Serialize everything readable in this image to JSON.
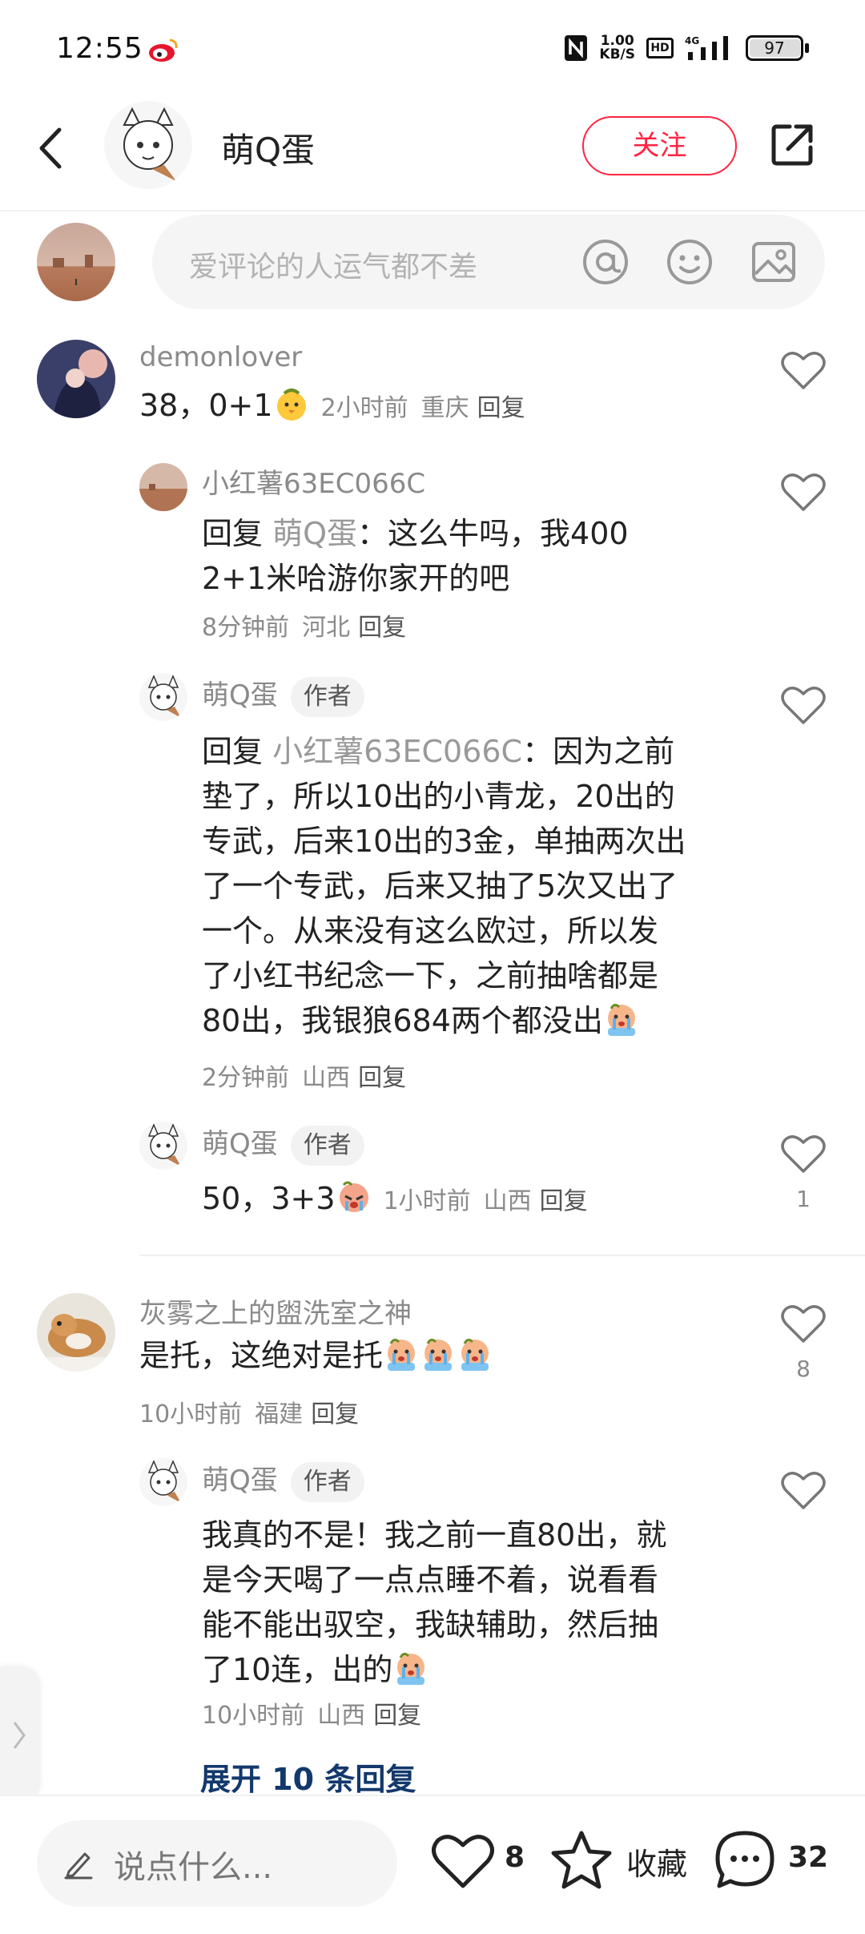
{
  "status_bar": {
    "time": "12:55",
    "net_speed_value": "1.00",
    "net_speed_unit": "KB/S",
    "hd": "HD",
    "signal": "4G",
    "battery": "97"
  },
  "header": {
    "author_name": "萌Q蛋",
    "follow_label": "关注"
  },
  "top_input": {
    "placeholder": "爱评论的人运气都不差"
  },
  "comments": [
    {
      "username": "demonlover",
      "text": "38，0+1",
      "time": "2小时前",
      "location": "重庆",
      "reply_label": "回复"
    },
    {
      "username": "小红薯63EC066C",
      "reply_prefix": "回复",
      "reply_to": "萌Q蛋",
      "text_line1": "：这么牛吗，我400",
      "text_line2": "2+1米哈游你家开的吧",
      "time": "8分钟前",
      "location": "河北",
      "reply_label": "回复"
    },
    {
      "username": "萌Q蛋",
      "badge": "作者",
      "reply_prefix": "回复",
      "reply_to": "小红薯63EC066C",
      "text_line1": "：因为之前",
      "text_lines": [
        "垫了，所以10出的小青龙，20出的",
        "专武，后来10出的3金，单抽两次出",
        "了一个专武，后来又抽了5次又出了",
        "一个。从来没有这么欧过，所以发",
        "了小红书纪念一下，之前抽啥都是",
        "80出，我银狼684两个都没出"
      ],
      "time": "2分钟前",
      "location": "山西",
      "reply_label": "回复"
    },
    {
      "username": "萌Q蛋",
      "badge": "作者",
      "text": "50，3+3",
      "time": "1小时前",
      "location": "山西",
      "reply_label": "回复",
      "likes": "1"
    },
    {
      "username": "灰雾之上的盥洗室之神",
      "text": "是托，这绝对是托",
      "time": "10小时前",
      "location": "福建",
      "reply_label": "回复",
      "likes": "8"
    },
    {
      "username": "萌Q蛋",
      "badge": "作者",
      "text_lines": [
        "我真的不是！我之前一直80出，就",
        "是今天喝了一点点睡不着，说看看",
        "能不能出驭空，我缺辅助，然后抽",
        "了10连，出的"
      ],
      "time": "10小时前",
      "location": "山西",
      "reply_label": "回复"
    }
  ],
  "expand_replies_label": "展开 10 条回复",
  "bottom_bar": {
    "input_placeholder": "说点什么...",
    "like_count": "8",
    "collect_label": "收藏",
    "comment_count": "32"
  },
  "colors": {
    "accent": "#ff2442",
    "link": "#13386c",
    "meta": "#8a8a8a"
  }
}
